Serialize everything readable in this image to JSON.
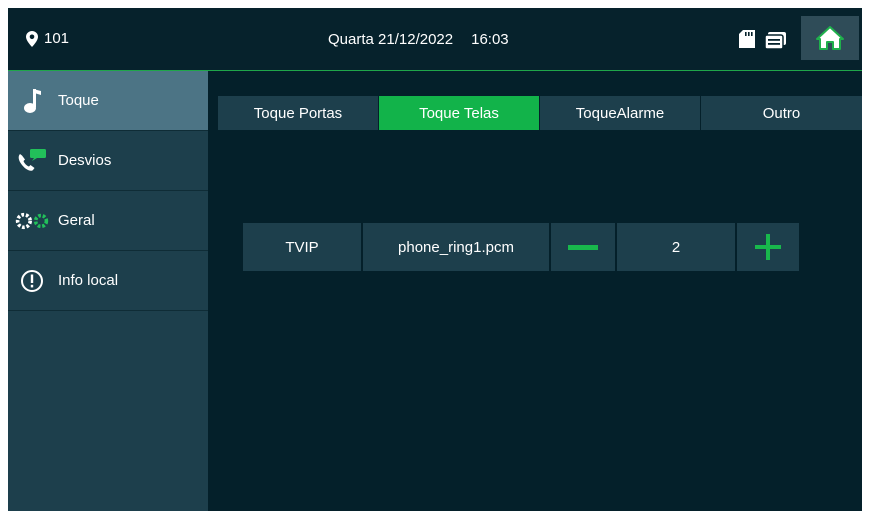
{
  "topbar": {
    "room": "101",
    "day": "Quarta",
    "date": "21/12/2022",
    "time": "16:03",
    "icons": [
      "location-pin-icon",
      "sd-card-icon",
      "message-icon",
      "home-icon"
    ],
    "accent": "#1fa64a"
  },
  "sidebar": {
    "items": [
      {
        "label": "Toque",
        "icon": "music-note-icon",
        "active": true
      },
      {
        "label": "Desvios",
        "icon": "call-forward-icon",
        "active": false
      },
      {
        "label": "Geral",
        "icon": "gears-icon",
        "active": false
      },
      {
        "label": "Info local",
        "icon": "info-icon",
        "active": false
      }
    ]
  },
  "tabs": [
    {
      "label": "Toque Portas",
      "active": false
    },
    {
      "label": "Toque Telas",
      "active": true
    },
    {
      "label": "ToqueAlarme",
      "active": false
    },
    {
      "label": "Outro",
      "active": false
    }
  ],
  "ringtone": {
    "device": "TVIP",
    "file": "phone_ring1.pcm",
    "volume": "2"
  },
  "colors": {
    "background": "#04202a",
    "panel": "#1d3f4c",
    "active_sidebar": "#4c7485",
    "active_tab": "#12b34a"
  }
}
